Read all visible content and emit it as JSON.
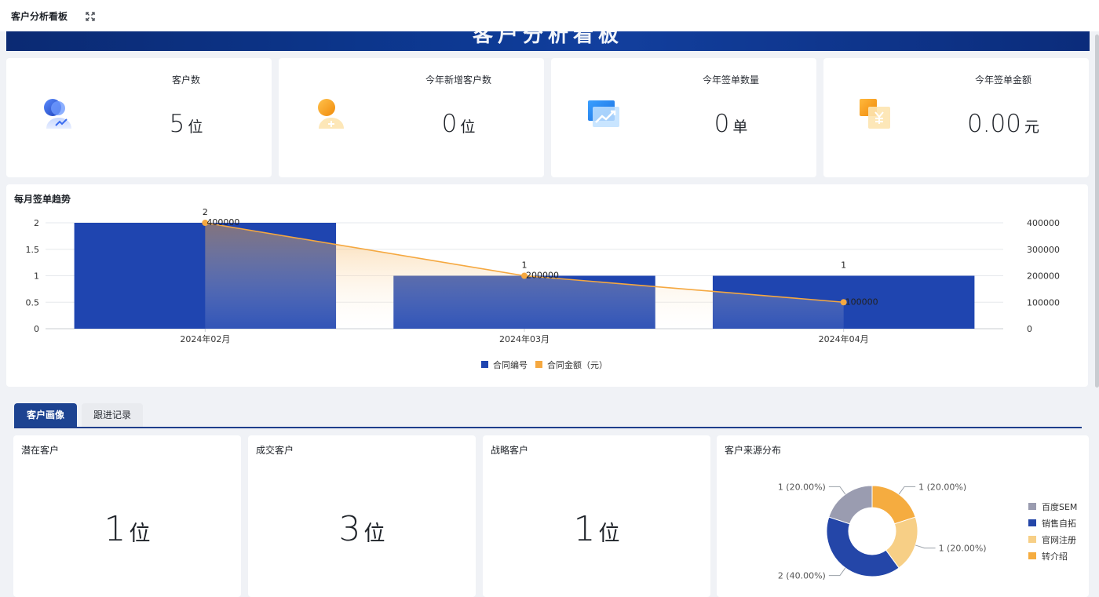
{
  "topbar": {
    "title": "客户分析看板"
  },
  "banner": {
    "title": "客户分析看板"
  },
  "stats": [
    {
      "label": "客户数",
      "value": "5",
      "unit": "位",
      "icon": "customers-icon",
      "color": "#2f5fd8"
    },
    {
      "label": "今年新增客户数",
      "value": "0",
      "unit": "位",
      "icon": "new-customer-icon",
      "color": "#f5a623"
    },
    {
      "label": "今年签单数量",
      "value": "0",
      "unit": "单",
      "icon": "trend-icon",
      "color": "#2d8cf0"
    },
    {
      "label": "今年签单金额",
      "value": "0.00",
      "unit": "元",
      "icon": "money-icon",
      "color": "#f5a623"
    }
  ],
  "trend": {
    "title": "每月签单趋势"
  },
  "chart_data": {
    "type": "bar",
    "title": "每月签单趋势",
    "categories": [
      "2024年02月",
      "2024年03月",
      "2024年04月"
    ],
    "series": [
      {
        "name": "合同编号",
        "type": "bar",
        "axis": "left",
        "values": [
          2,
          1,
          1
        ],
        "color": "#1f45b0"
      },
      {
        "name": "合同金额（元）",
        "type": "line",
        "axis": "right",
        "values": [
          400000,
          200000,
          100000
        ],
        "color": "#f5a840"
      }
    ],
    "y_left": {
      "ticks": [
        "0",
        "0.5",
        "1",
        "1.5",
        "2"
      ],
      "range": [
        0,
        2
      ]
    },
    "y_right": {
      "ticks": [
        "0",
        "100000",
        "200000",
        "300000",
        "400000"
      ],
      "range": [
        0,
        400000
      ]
    },
    "legend": "bottom-center",
    "grid": true
  },
  "tabs": {
    "active": "客户画像",
    "inactive": "跟进记录"
  },
  "portrait": [
    {
      "title": "潜在客户",
      "value": "1",
      "unit": "位"
    },
    {
      "title": "成交客户",
      "value": "3",
      "unit": "位"
    },
    {
      "title": "战略客户",
      "value": "1",
      "unit": "位"
    }
  ],
  "source": {
    "title": "客户来源分布",
    "chart_data": {
      "type": "pie",
      "slices": [
        {
          "name": "百度SEM",
          "value": 1,
          "label": "1 (20.00%)",
          "color": "#9a9cb0"
        },
        {
          "name": "销售自拓",
          "value": 2,
          "label": "2 (40.00%)",
          "color": "#2446a8"
        },
        {
          "name": "官网注册",
          "value": 1,
          "label": "1 (20.00%)",
          "color": "#f7cf86"
        },
        {
          "name": "转介绍",
          "value": 1,
          "label": "1 (20.00%)",
          "color": "#f5ac40"
        }
      ],
      "legend": "right"
    }
  }
}
